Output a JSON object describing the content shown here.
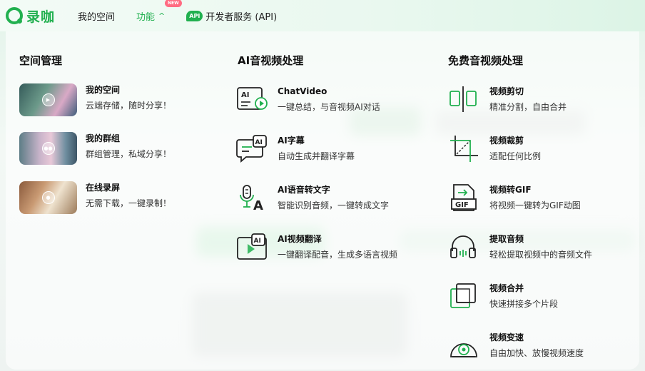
{
  "brand": {
    "name": "录咖",
    "color": "#21b04f"
  },
  "nav": {
    "items": [
      {
        "label": "我的空间"
      },
      {
        "label": "功能",
        "badge": "NEW",
        "active": true
      },
      {
        "label": "开发者服务 (API)",
        "icon_label": "API"
      }
    ]
  },
  "sections": [
    {
      "title": "空间管理",
      "items": [
        {
          "title": "我的空间",
          "desc": "云端存储，随时分享！",
          "icon": "play-circle-icon"
        },
        {
          "title": "我的群组",
          "desc": "群组管理，私域分享！",
          "icon": "group-icon"
        },
        {
          "title": "在线录屏",
          "desc": "无需下载，一键录制！",
          "icon": "record-icon"
        }
      ]
    },
    {
      "title": "AI音视频处理",
      "items": [
        {
          "title": "ChatVideo",
          "desc": "一键总结，与音视频AI对话",
          "icon": "ai-chat-icon",
          "icon_label": "AI"
        },
        {
          "title": "AI字幕",
          "desc": "自动生成并翻译字幕",
          "icon": "ai-subtitle-icon",
          "icon_label": "AI"
        },
        {
          "title": "AI语音转文字",
          "desc": "智能识别音频，一键转成文字",
          "icon": "speech-to-text-icon",
          "icon_label": "A"
        },
        {
          "title": "AI视频翻译",
          "desc": "一键翻译配音，生成多语言视频",
          "icon": "ai-video-translate-icon",
          "icon_label": "AI"
        }
      ]
    },
    {
      "title": "免费音视频处理",
      "items": [
        {
          "title": "视频剪切",
          "desc": "精准分割，自由合并",
          "icon": "video-cut-icon"
        },
        {
          "title": "视频裁剪",
          "desc": "适配任何比例",
          "icon": "crop-icon"
        },
        {
          "title": "视频转GIF",
          "desc": "将视频一键转为GIF动图",
          "icon": "gif-icon",
          "icon_label": "GIF"
        },
        {
          "title": "提取音频",
          "desc": "轻松提取视频中的音频文件",
          "icon": "headphones-icon"
        },
        {
          "title": "视频合并",
          "desc": "快速拼接多个片段",
          "icon": "merge-icon"
        },
        {
          "title": "视频变速",
          "desc": "自由加快、放慢视频速度",
          "icon": "speed-icon"
        }
      ]
    }
  ]
}
